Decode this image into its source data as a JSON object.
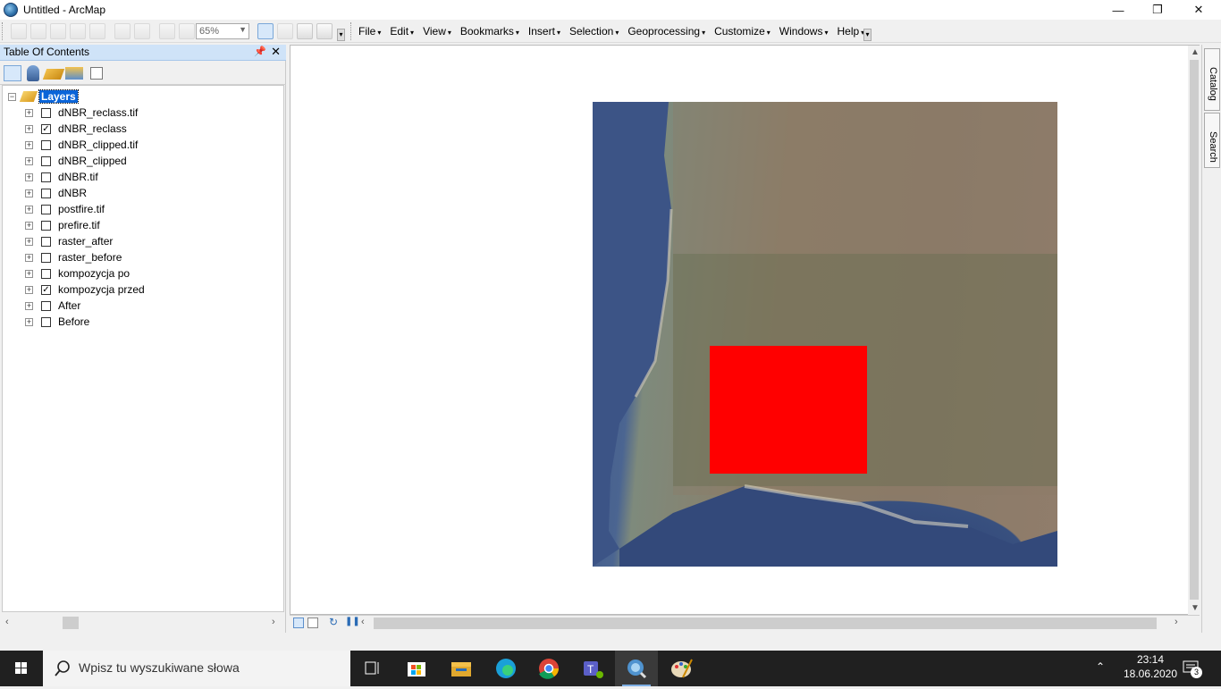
{
  "window": {
    "title": "Untitled - ArcMap"
  },
  "toolbar": {
    "zoom_value": "65%"
  },
  "menu": {
    "items": [
      "File",
      "Edit",
      "View",
      "Bookmarks",
      "Insert",
      "Selection",
      "Geoprocessing",
      "Customize",
      "Windows",
      "Help"
    ]
  },
  "toc": {
    "title": "Table Of Contents",
    "root": "Layers",
    "layers": [
      {
        "name": "dNBR_reclass.tif",
        "checked": false
      },
      {
        "name": "dNBR_reclass",
        "checked": true
      },
      {
        "name": "dNBR_clipped.tif",
        "checked": false
      },
      {
        "name": "dNBR_clipped",
        "checked": false
      },
      {
        "name": "dNBR.tif",
        "checked": false
      },
      {
        "name": "dNBR",
        "checked": false
      },
      {
        "name": "postfire.tif",
        "checked": false
      },
      {
        "name": "prefire.tif",
        "checked": false
      },
      {
        "name": "raster_after",
        "checked": false
      },
      {
        "name": "raster_before",
        "checked": false
      },
      {
        "name": "kompozycja po",
        "checked": false
      },
      {
        "name": "kompozycja przed",
        "checked": true
      },
      {
        "name": "After",
        "checked": false
      },
      {
        "name": "Before",
        "checked": false
      }
    ]
  },
  "dock": {
    "catalog": "Catalog",
    "search": "Search"
  },
  "taskbar": {
    "search_placeholder": "Wpisz tu wyszukiwane słowa",
    "time": "23:14",
    "date": "18.06.2020",
    "notifications": "3"
  },
  "colors": {
    "selection": "#0a64d8",
    "red_overlay": "#ff0000",
    "toc_header": "#cfe3f8"
  }
}
